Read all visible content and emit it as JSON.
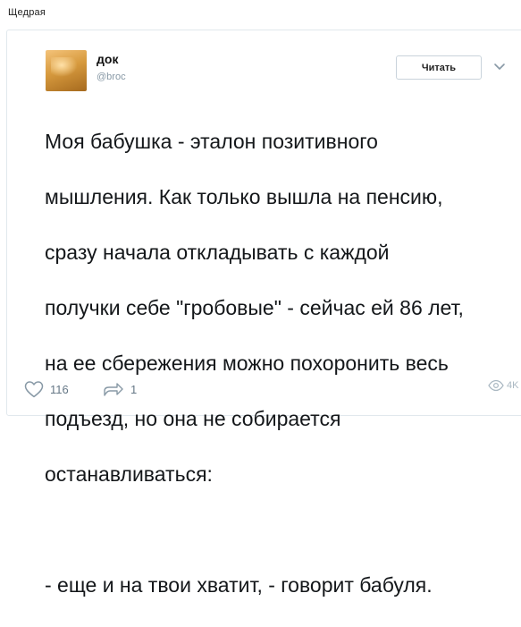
{
  "page": {
    "title": "Щедрая"
  },
  "tweet": {
    "author": {
      "name": "док",
      "handle": "@broc"
    },
    "follow_label": "Читать",
    "text_lines": [
      "Моя бабушка - эталон позитивного",
      "мышления. Как только вышла на пенсию,",
      "сразу начала откладывать с каждой",
      "получки себе \"гробовые\" - сейчас ей 86 лет,",
      "на ее сбережения можно похоронить весь",
      "подъезд, но она не собирается",
      "останавливаться:",
      "",
      "- еще и на твои хватит, - говорит бабуля."
    ],
    "actions": {
      "likes": "116",
      "retweets": "1",
      "views": "4K"
    }
  },
  "icons": {
    "like": "heart-icon",
    "retweet": "share-arrow-icon",
    "views": "eye-icon",
    "menu": "chevron-down-icon"
  },
  "colors": {
    "text": "#14171a",
    "muted": "#657786",
    "border": "#e1e8ed"
  }
}
